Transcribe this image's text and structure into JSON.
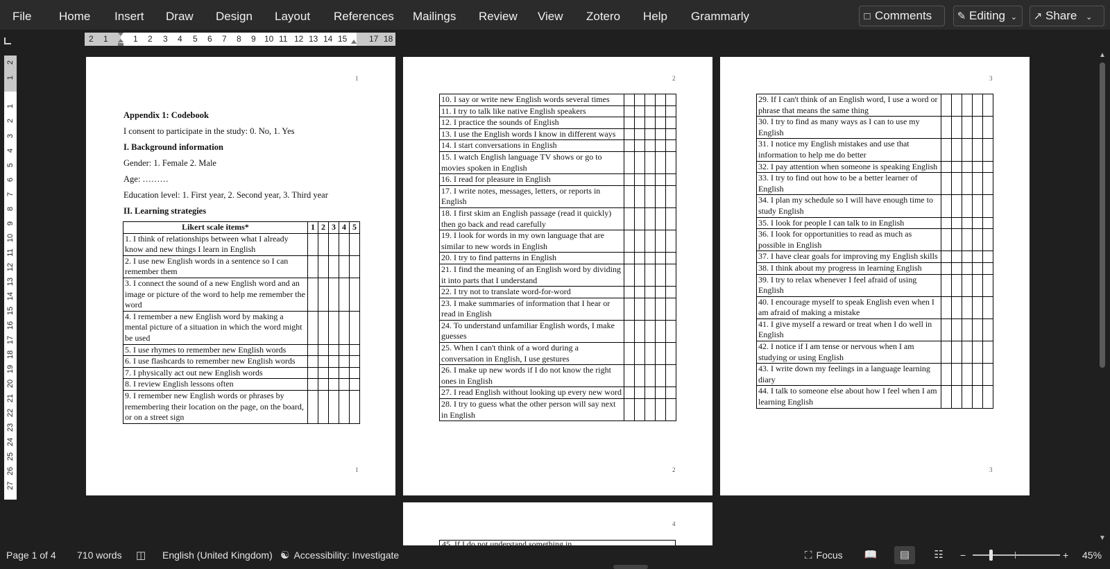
{
  "ribbon": {
    "tabs": [
      "File",
      "Home",
      "Insert",
      "Draw",
      "Design",
      "Layout",
      "References",
      "Mailings",
      "Review",
      "View",
      "Zotero",
      "Help",
      "Grammarly"
    ],
    "comments_label": "Comments",
    "editing_label": "Editing",
    "share_label": "Share"
  },
  "ruler": {
    "h_numbers": [
      "2",
      "1",
      "1",
      "2",
      "3",
      "4",
      "5",
      "6",
      "7",
      "8",
      "9",
      "10",
      "11",
      "12",
      "13",
      "14",
      "15",
      "17",
      "18"
    ],
    "v_numbers": [
      "2",
      "1",
      "1",
      "2",
      "3",
      "4",
      "5",
      "6",
      "7",
      "8",
      "9",
      "10",
      "11",
      "12",
      "13",
      "14",
      "15",
      "16",
      "17",
      "18",
      "19",
      "20",
      "21",
      "22",
      "23",
      "24",
      "25",
      "26",
      "27"
    ]
  },
  "pages": [
    {
      "header_num": "1",
      "footer_num": "1",
      "heading": "Appendix 1: Codebook",
      "consent": "I consent to participate in the study: 0. No, 1. Yes",
      "section1": "I. Background information",
      "gender": "Gender: 1. Female 2. Male",
      "age": "Age: ………",
      "education": "Education level: 1. First year, 2. Second year, 3. Third year",
      "section2": "II. Learning strategies",
      "table_header": "Likert scale items*",
      "scale": [
        "1",
        "2",
        "3",
        "4",
        "5"
      ],
      "items": [
        "1. I think of relationships between what I already know and new things I learn in English",
        "2. I use new English words in a sentence so I can remember them",
        "3. I connect the sound of a new English word and an image or picture of the word to help me remember the word",
        "4. I remember a new English word by making a mental picture of a situation in which the word might be used",
        "5. I use rhymes to remember new English words",
        "6. I use flashcards to remember new English words",
        "7. I physically act out new English words",
        "8. I review English lessons often",
        "9. I remember new English words or phrases by remembering their location on the page, on the board, or on a street sign"
      ]
    },
    {
      "header_num": "2",
      "footer_num": "2",
      "items": [
        "10. I say or write new English words several times",
        "11. I try to talk like native English speakers",
        "12. I practice the sounds of English",
        "13. I use the English words I know in different ways",
        "14. I start conversations in English",
        "15. I watch English language TV shows or go to movies spoken in English",
        "16. I read for pleasure in English",
        "17. I write notes, messages, letters, or reports in English",
        "18. I first skim an English passage (read it quickly) then go back and read carefully",
        "19. I look for words in my own language that are similar to new words in English",
        "20. I try to find patterns in English",
        "21. I find the meaning of an English word by dividing it into parts that I understand",
        "22. I try not to translate word-for-word",
        "23. I make summaries of information that I hear or read in English",
        "24. To understand unfamiliar English words, I make guesses",
        "25. When I can't think of a word during a conversation in English, I use gestures",
        "26. I make up new words if I do not know the right ones in English",
        "27. I read English without looking up every new word",
        "28. I try to guess what the other person will say next in English"
      ]
    },
    {
      "header_num": "3",
      "footer_num": "3",
      "items": [
        "29. If I can't think of an English word, I use a word or phrase that means the same thing",
        "30. I try to find as many ways as I can to use my English",
        "31. I notice my English mistakes and use that information to help me do better",
        "32. I pay attention when someone is speaking English",
        "33. I try to find out how to be a better learner of English",
        "34. I plan my schedule so I will have enough time to study English",
        "35. I look for people I can talk to in English",
        "36. I look for opportunities to read as much as possible in English",
        "37. I have clear goals for improving my English skills",
        "38. I think about my progress in learning English",
        "39. I try to relax whenever I feel afraid of using English",
        "40. I encourage myself to speak English even when I am afraid of making a mistake",
        "41. I give myself a reward or treat when I do well in English",
        "42. I notice if I am tense or nervous when I am studying or using English",
        "43. I write down my feelings in a language learning diary",
        "44. I talk to someone else about how I feel when I am learning English"
      ]
    },
    {
      "header_num": "4",
      "first_item_partial": "45. If I do not understand something in"
    }
  ],
  "status": {
    "page": "Page 1 of 4",
    "words": "710 words",
    "language": "English (United Kingdom)",
    "accessibility": "Accessibility: Investigate",
    "focus": "Focus",
    "zoom_minus": "−",
    "zoom_plus": "+",
    "zoom": "45%"
  },
  "colors": {
    "ribbon_bg": "#2b2b2b",
    "canvas_bg": "#1f1f1f",
    "text_light": "#f0f0f0"
  }
}
